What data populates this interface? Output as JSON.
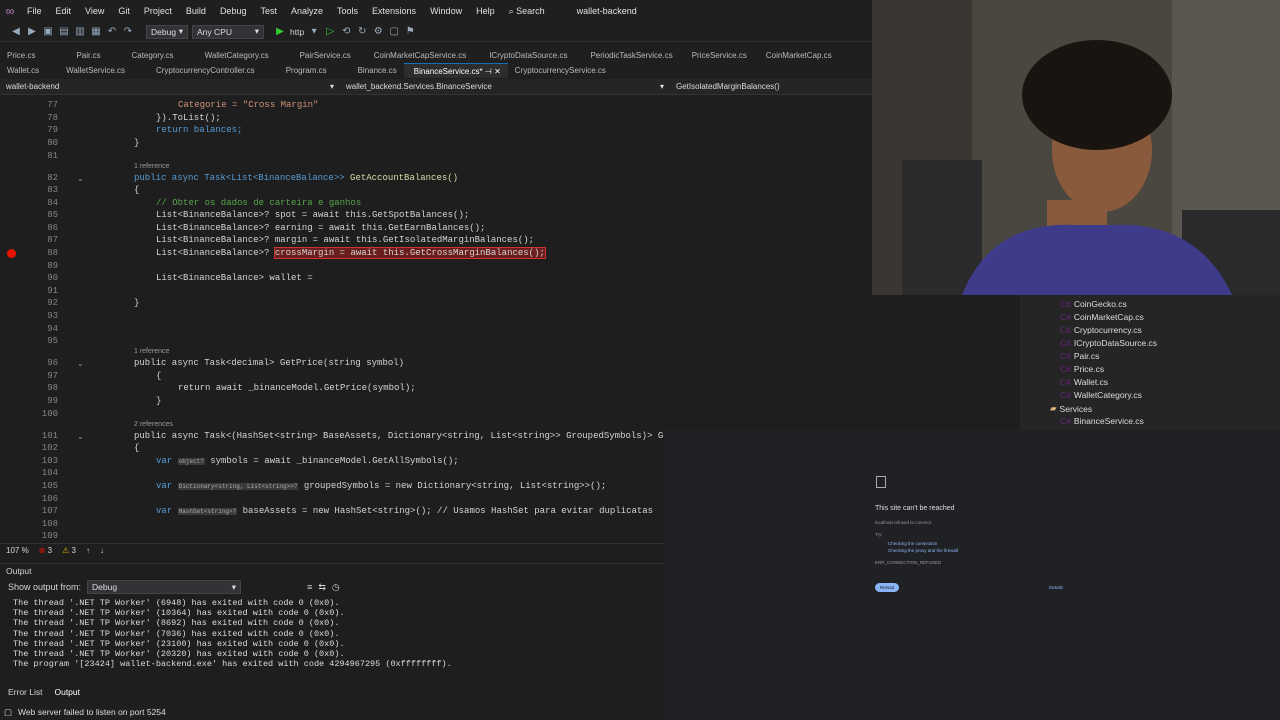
{
  "menubar": {
    "items": [
      "File",
      "Edit",
      "View",
      "Git",
      "Project",
      "Build",
      "Debug",
      "Test",
      "Analyze",
      "Tools",
      "Extensions",
      "Window",
      "Help"
    ],
    "search": "Search",
    "solution": "wallet-backend"
  },
  "toolbar": {
    "config": "Debug",
    "platform": "Any CPU",
    "run": "http"
  },
  "tabs_row1": [
    "Price.cs",
    "Pair.cs",
    "Category.cs",
    "WalletCategory.cs",
    "PairService.cs",
    "CoinMarketCapService.cs",
    "ICryptoDataSource.cs",
    "PeriodicTaskService.cs",
    "PriceService.cs",
    "CoinMarketCap.cs"
  ],
  "tabs_row2": [
    "Wallet.cs",
    "WalletService.cs",
    "CryptocurrencyController.cs",
    "Program.cs",
    "Binance.cs",
    "BinanceService.cs*",
    "CryptocurrencyService.cs"
  ],
  "navbar": {
    "project": "wallet-backend",
    "class": "wallet_backend.Services.BinanceService",
    "member": "GetIsolatedMarginBalances()"
  },
  "code": {
    "l76": "Categorie = \"Cross Margin\"",
    "l78": "}).ToList();",
    "l79": "return balances;",
    "l80": "}",
    "ref1": "1 reference",
    "l82a": "public async Task<List<BinanceBalance>> ",
    "l82b": "GetAccountBalances()",
    "l83": "{",
    "l84": "// Obter os dados de carteira e ganhos",
    "l85": "List<BinanceBalance>? spot = await this.GetSpotBalances();",
    "l86": "List<BinanceBalance>? earning = await this.GetEarnBalances();",
    "l87": "List<BinanceBalance>? margin = await this.GetIsolatedMarginBalances();",
    "l88a": "List<BinanceBalance>? ",
    "l88b": "crossMargin = await this.GetCrossMarginBalances();",
    "l90": "List<BinanceBalance> wallet = ",
    "l92": "}",
    "ref2": "1 reference",
    "l96": "public async Task<decimal> GetPrice(string symbol)",
    "l97": "{",
    "l98": "return await _binanceModel.GetPrice(symbol);",
    "l99": "}",
    "ref3": "2 references",
    "l101": "public async Task<(HashSet<string> BaseAssets, Dictionary<string, List<string>> GroupedSymbols)> G",
    "l102": "{",
    "l103a": "var ",
    "l103h": "object?",
    "l103b": " symbols = await _binanceModel.GetAllSymbols();",
    "l105a": "var ",
    "l105h": "Dictionary<string, List<string>>?",
    "l105b": " groupedSymbols = new Dictionary<string, List<string>>();",
    "l107a": "var ",
    "l107h": "HashSet<string>?",
    "l107b": " baseAssets = new HashSet<string>(); // Usamos HashSet para evitar duplicatas"
  },
  "line_numbers": [
    "77",
    "78",
    "79",
    "80",
    "81",
    "82",
    "83",
    "84",
    "85",
    "86",
    "87",
    "88",
    "89",
    "90",
    "91",
    "92",
    "93",
    "94",
    "95",
    "96",
    "97",
    "98",
    "99",
    "100",
    "101",
    "102",
    "103",
    "104",
    "105",
    "106",
    "107",
    "108",
    "109"
  ],
  "editor_status": {
    "zoom": "107 %",
    "errors": "3",
    "warnings": "3"
  },
  "output": {
    "title": "Output",
    "show_from_label": "Show output from:",
    "source": "Debug",
    "lines": [
      "The thread '.NET TP Worker' (6948) has exited with code 0 (0x0).",
      "The thread '.NET TP Worker' (10364) has exited with code 0 (0x0).",
      "The thread '.NET TP Worker' (8692) has exited with code 0 (0x0).",
      "The thread '.NET TP Worker' (7036) has exited with code 0 (0x0).",
      "The thread '.NET TP Worker' (23100) has exited with code 0 (0x0).",
      "The thread '.NET TP Worker' (20320) has exited with code 0 (0x0).",
      "The program '[23424] wallet-backend.exe' has exited with code 4294967295 (0xffffffff)."
    ]
  },
  "bottom_tabs": [
    "Error List",
    "Output"
  ],
  "status": "Web server failed to listen on port 5254",
  "solution_explorer": [
    "CoinGecko.cs",
    "CoinMarketCap.cs",
    "Cryptocurrency.cs",
    "ICryptoDataSource.cs",
    "Pair.cs",
    "Price.cs",
    "Wallet.cs",
    "WalletCategory.cs",
    "Services",
    "BinanceService.cs"
  ],
  "browser": {
    "title": "This site can't be reached",
    "line1": "localhost refused to connect.",
    "try": "Try:",
    "b1": "Checking the connection",
    "b2": "Checking the proxy and the firewall",
    "code": "ERR_CONNECTION_REFUSED",
    "reload": "Reload",
    "details": "Details"
  }
}
